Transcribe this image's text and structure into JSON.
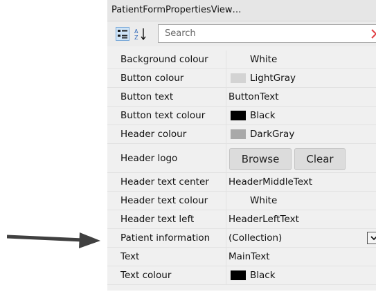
{
  "window": {
    "title": "PatientFormPropertiesView…"
  },
  "toolbar": {
    "categorized_icon": "categorized-sort-icon",
    "alphabetical_icon": "alphabetical-sort-icon",
    "search_placeholder": "Search",
    "search_value": "",
    "clear_icon": "clear-x-icon",
    "clear_color": "#e0393e"
  },
  "properties": [
    {
      "name": "Background colour",
      "value": "White",
      "swatch": "#ffffff"
    },
    {
      "name": "Button colour",
      "value": "LightGray",
      "swatch": "#d3d3d3"
    },
    {
      "name": "Button text",
      "value": "ButtonText"
    },
    {
      "name": "Button text colour",
      "value": "Black",
      "swatch": "#000000"
    },
    {
      "name": "Header colour",
      "value": "DarkGray",
      "swatch": "#a9a9a9"
    },
    {
      "name": "Header logo",
      "buttons": {
        "browse": "Browse",
        "clear": "Clear"
      }
    },
    {
      "name": "Header text center",
      "value": "HeaderMiddleText"
    },
    {
      "name": "Header text colour",
      "value": "White",
      "swatch": "#ffffff"
    },
    {
      "name": "Header text left",
      "value": "HeaderLeftText"
    },
    {
      "name": "Patient information",
      "value": "(Collection)",
      "dropdown_icon": "chevron-down-icon"
    },
    {
      "name": "Text",
      "value": "MainText"
    },
    {
      "name": "Text colour",
      "value": "Black",
      "swatch": "#000000"
    }
  ],
  "annotation": {
    "icon": "arrow-right-icon",
    "color": "#404040"
  }
}
